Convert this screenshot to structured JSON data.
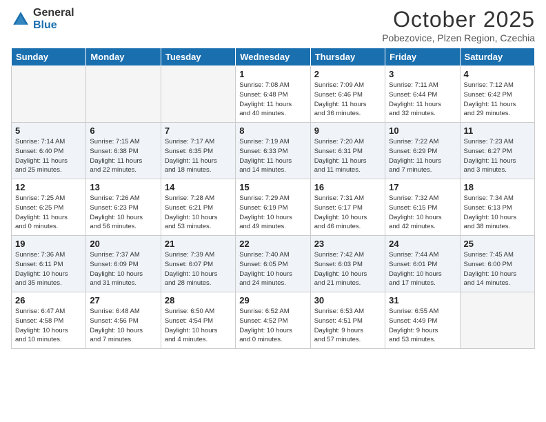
{
  "header": {
    "logo_general": "General",
    "logo_blue": "Blue",
    "month": "October 2025",
    "location": "Pobezovice, Plzen Region, Czechia"
  },
  "weekdays": [
    "Sunday",
    "Monday",
    "Tuesday",
    "Wednesday",
    "Thursday",
    "Friday",
    "Saturday"
  ],
  "weeks": [
    [
      {
        "day": "",
        "info": ""
      },
      {
        "day": "",
        "info": ""
      },
      {
        "day": "",
        "info": ""
      },
      {
        "day": "1",
        "info": "Sunrise: 7:08 AM\nSunset: 6:48 PM\nDaylight: 11 hours\nand 40 minutes."
      },
      {
        "day": "2",
        "info": "Sunrise: 7:09 AM\nSunset: 6:46 PM\nDaylight: 11 hours\nand 36 minutes."
      },
      {
        "day": "3",
        "info": "Sunrise: 7:11 AM\nSunset: 6:44 PM\nDaylight: 11 hours\nand 32 minutes."
      },
      {
        "day": "4",
        "info": "Sunrise: 7:12 AM\nSunset: 6:42 PM\nDaylight: 11 hours\nand 29 minutes."
      }
    ],
    [
      {
        "day": "5",
        "info": "Sunrise: 7:14 AM\nSunset: 6:40 PM\nDaylight: 11 hours\nand 25 minutes."
      },
      {
        "day": "6",
        "info": "Sunrise: 7:15 AM\nSunset: 6:38 PM\nDaylight: 11 hours\nand 22 minutes."
      },
      {
        "day": "7",
        "info": "Sunrise: 7:17 AM\nSunset: 6:35 PM\nDaylight: 11 hours\nand 18 minutes."
      },
      {
        "day": "8",
        "info": "Sunrise: 7:19 AM\nSunset: 6:33 PM\nDaylight: 11 hours\nand 14 minutes."
      },
      {
        "day": "9",
        "info": "Sunrise: 7:20 AM\nSunset: 6:31 PM\nDaylight: 11 hours\nand 11 minutes."
      },
      {
        "day": "10",
        "info": "Sunrise: 7:22 AM\nSunset: 6:29 PM\nDaylight: 11 hours\nand 7 minutes."
      },
      {
        "day": "11",
        "info": "Sunrise: 7:23 AM\nSunset: 6:27 PM\nDaylight: 11 hours\nand 3 minutes."
      }
    ],
    [
      {
        "day": "12",
        "info": "Sunrise: 7:25 AM\nSunset: 6:25 PM\nDaylight: 11 hours\nand 0 minutes."
      },
      {
        "day": "13",
        "info": "Sunrise: 7:26 AM\nSunset: 6:23 PM\nDaylight: 10 hours\nand 56 minutes."
      },
      {
        "day": "14",
        "info": "Sunrise: 7:28 AM\nSunset: 6:21 PM\nDaylight: 10 hours\nand 53 minutes."
      },
      {
        "day": "15",
        "info": "Sunrise: 7:29 AM\nSunset: 6:19 PM\nDaylight: 10 hours\nand 49 minutes."
      },
      {
        "day": "16",
        "info": "Sunrise: 7:31 AM\nSunset: 6:17 PM\nDaylight: 10 hours\nand 46 minutes."
      },
      {
        "day": "17",
        "info": "Sunrise: 7:32 AM\nSunset: 6:15 PM\nDaylight: 10 hours\nand 42 minutes."
      },
      {
        "day": "18",
        "info": "Sunrise: 7:34 AM\nSunset: 6:13 PM\nDaylight: 10 hours\nand 38 minutes."
      }
    ],
    [
      {
        "day": "19",
        "info": "Sunrise: 7:36 AM\nSunset: 6:11 PM\nDaylight: 10 hours\nand 35 minutes."
      },
      {
        "day": "20",
        "info": "Sunrise: 7:37 AM\nSunset: 6:09 PM\nDaylight: 10 hours\nand 31 minutes."
      },
      {
        "day": "21",
        "info": "Sunrise: 7:39 AM\nSunset: 6:07 PM\nDaylight: 10 hours\nand 28 minutes."
      },
      {
        "day": "22",
        "info": "Sunrise: 7:40 AM\nSunset: 6:05 PM\nDaylight: 10 hours\nand 24 minutes."
      },
      {
        "day": "23",
        "info": "Sunrise: 7:42 AM\nSunset: 6:03 PM\nDaylight: 10 hours\nand 21 minutes."
      },
      {
        "day": "24",
        "info": "Sunrise: 7:44 AM\nSunset: 6:01 PM\nDaylight: 10 hours\nand 17 minutes."
      },
      {
        "day": "25",
        "info": "Sunrise: 7:45 AM\nSunset: 6:00 PM\nDaylight: 10 hours\nand 14 minutes."
      }
    ],
    [
      {
        "day": "26",
        "info": "Sunrise: 6:47 AM\nSunset: 4:58 PM\nDaylight: 10 hours\nand 10 minutes."
      },
      {
        "day": "27",
        "info": "Sunrise: 6:48 AM\nSunset: 4:56 PM\nDaylight: 10 hours\nand 7 minutes."
      },
      {
        "day": "28",
        "info": "Sunrise: 6:50 AM\nSunset: 4:54 PM\nDaylight: 10 hours\nand 4 minutes."
      },
      {
        "day": "29",
        "info": "Sunrise: 6:52 AM\nSunset: 4:52 PM\nDaylight: 10 hours\nand 0 minutes."
      },
      {
        "day": "30",
        "info": "Sunrise: 6:53 AM\nSunset: 4:51 PM\nDaylight: 9 hours\nand 57 minutes."
      },
      {
        "day": "31",
        "info": "Sunrise: 6:55 AM\nSunset: 4:49 PM\nDaylight: 9 hours\nand 53 minutes."
      },
      {
        "day": "",
        "info": ""
      }
    ]
  ]
}
